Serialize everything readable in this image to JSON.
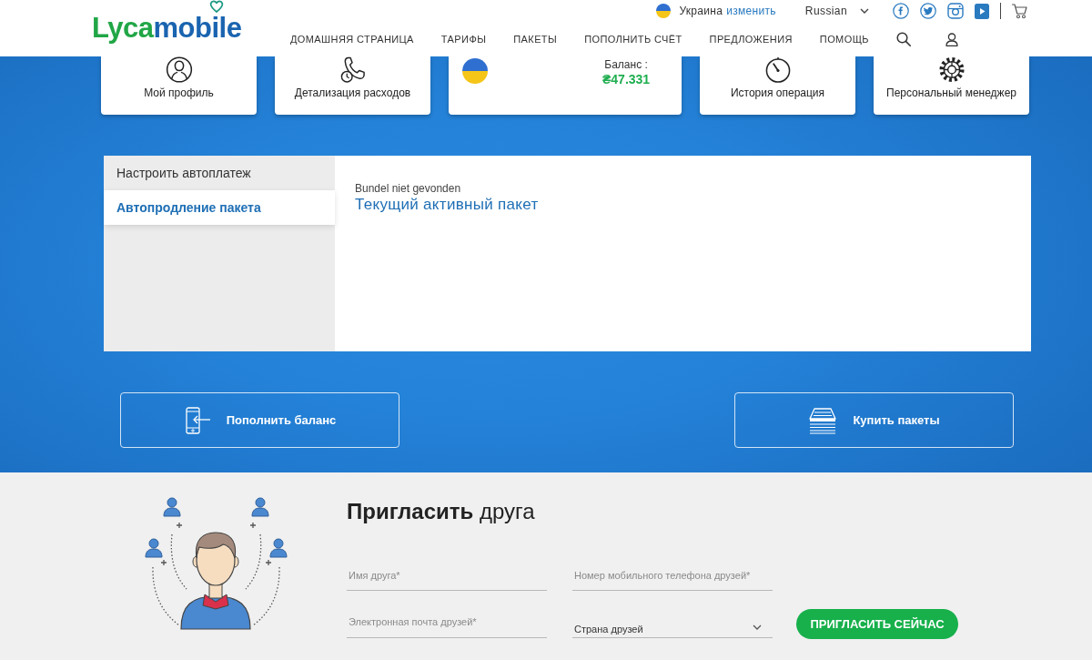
{
  "header": {
    "logo": [
      "Lyca",
      "mobile"
    ],
    "country": "Украина",
    "change_link": "изменить",
    "language": "Russian",
    "nav": [
      "ДОМАШНЯЯ СТРАНИЦА",
      "ТАРИФЫ",
      "ПАКЕТЫ",
      "ПОПОЛНИТЬ СЧЁТ",
      "ПРЕДЛОЖЕНИЯ",
      "ПОМОЩЬ"
    ]
  },
  "cards": [
    {
      "kind": "link",
      "label": "Мой профиль"
    },
    {
      "kind": "link",
      "label": "Детализация расходов"
    },
    {
      "kind": "balance",
      "label": "Баланс :",
      "amount": "₴47.331"
    },
    {
      "kind": "link",
      "label": "История операция"
    },
    {
      "kind": "link",
      "label": "Персональный менеджер"
    }
  ],
  "autopay": {
    "tabs": [
      {
        "label": "Настроить автоплатеж",
        "selected": false
      },
      {
        "label": "Автопродление пакета",
        "selected": true
      }
    ],
    "status": "Bundel niet gevonden",
    "title": "Текущий активный пакет"
  },
  "actions": [
    "Пополнить баланс",
    "Купить пакеты"
  ],
  "invite": {
    "heading": "**Пригласить** друга",
    "fields": [
      {
        "kind": "input",
        "placeholder": "Имя друга*"
      },
      {
        "kind": "input",
        "placeholder": "Номер мобильного телефона друзей*"
      },
      {
        "kind": "input",
        "placeholder": "Электронная почта друзей*"
      },
      {
        "kind": "select",
        "value": "Страна друзей"
      }
    ],
    "button": "ПРИГЛАСИТЬ СЕЙЧАС"
  }
}
